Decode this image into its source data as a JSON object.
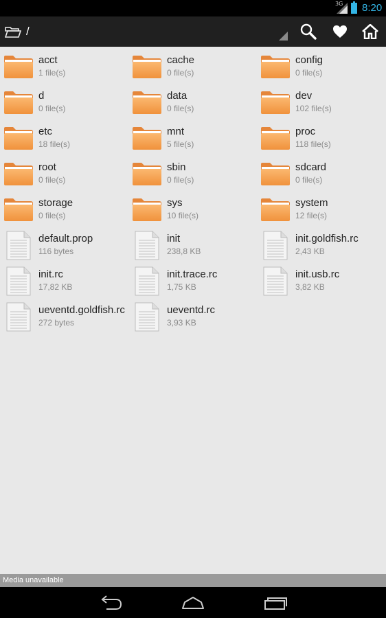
{
  "status_bar": {
    "network": "3G",
    "time": "8:20"
  },
  "action_bar": {
    "path": "/",
    "icons": [
      "folder-icon",
      "search-icon",
      "heart-icon",
      "home-icon"
    ]
  },
  "files": [
    {
      "name": "acct",
      "meta": "1 file(s)",
      "type": "folder"
    },
    {
      "name": "cache",
      "meta": "0 file(s)",
      "type": "folder"
    },
    {
      "name": "config",
      "meta": "0 file(s)",
      "type": "folder"
    },
    {
      "name": "d",
      "meta": "0 file(s)",
      "type": "folder"
    },
    {
      "name": "data",
      "meta": "0 file(s)",
      "type": "folder"
    },
    {
      "name": "dev",
      "meta": "102 file(s)",
      "type": "folder"
    },
    {
      "name": "etc",
      "meta": "18 file(s)",
      "type": "folder"
    },
    {
      "name": "mnt",
      "meta": "5 file(s)",
      "type": "folder"
    },
    {
      "name": "proc",
      "meta": "118 file(s)",
      "type": "folder"
    },
    {
      "name": "root",
      "meta": "0 file(s)",
      "type": "folder"
    },
    {
      "name": "sbin",
      "meta": "0 file(s)",
      "type": "folder"
    },
    {
      "name": "sdcard",
      "meta": "0 file(s)",
      "type": "folder"
    },
    {
      "name": "storage",
      "meta": "0 file(s)",
      "type": "folder"
    },
    {
      "name": "sys",
      "meta": "10 file(s)",
      "type": "folder"
    },
    {
      "name": "system",
      "meta": "12 file(s)",
      "type": "folder"
    },
    {
      "name": "default.prop",
      "meta": "116 bytes",
      "type": "file"
    },
    {
      "name": "init",
      "meta": "238,8 KB",
      "type": "file"
    },
    {
      "name": "init.goldfish.rc",
      "meta": "2,43 KB",
      "type": "file"
    },
    {
      "name": "init.rc",
      "meta": "17,82 KB",
      "type": "file"
    },
    {
      "name": "init.trace.rc",
      "meta": "1,75 KB",
      "type": "file"
    },
    {
      "name": "init.usb.rc",
      "meta": "3,82 KB",
      "type": "file"
    },
    {
      "name": "ueventd.goldfish.rc",
      "meta": "272 bytes",
      "type": "file"
    },
    {
      "name": "ueventd.rc",
      "meta": "3,93 KB",
      "type": "file"
    }
  ],
  "footer": {
    "status": "Media unavailable"
  },
  "colors": {
    "folder_top": "#fbb870",
    "folder_bottom": "#f0923c",
    "accent": "#33b5e5",
    "background": "#e8e8e8"
  }
}
